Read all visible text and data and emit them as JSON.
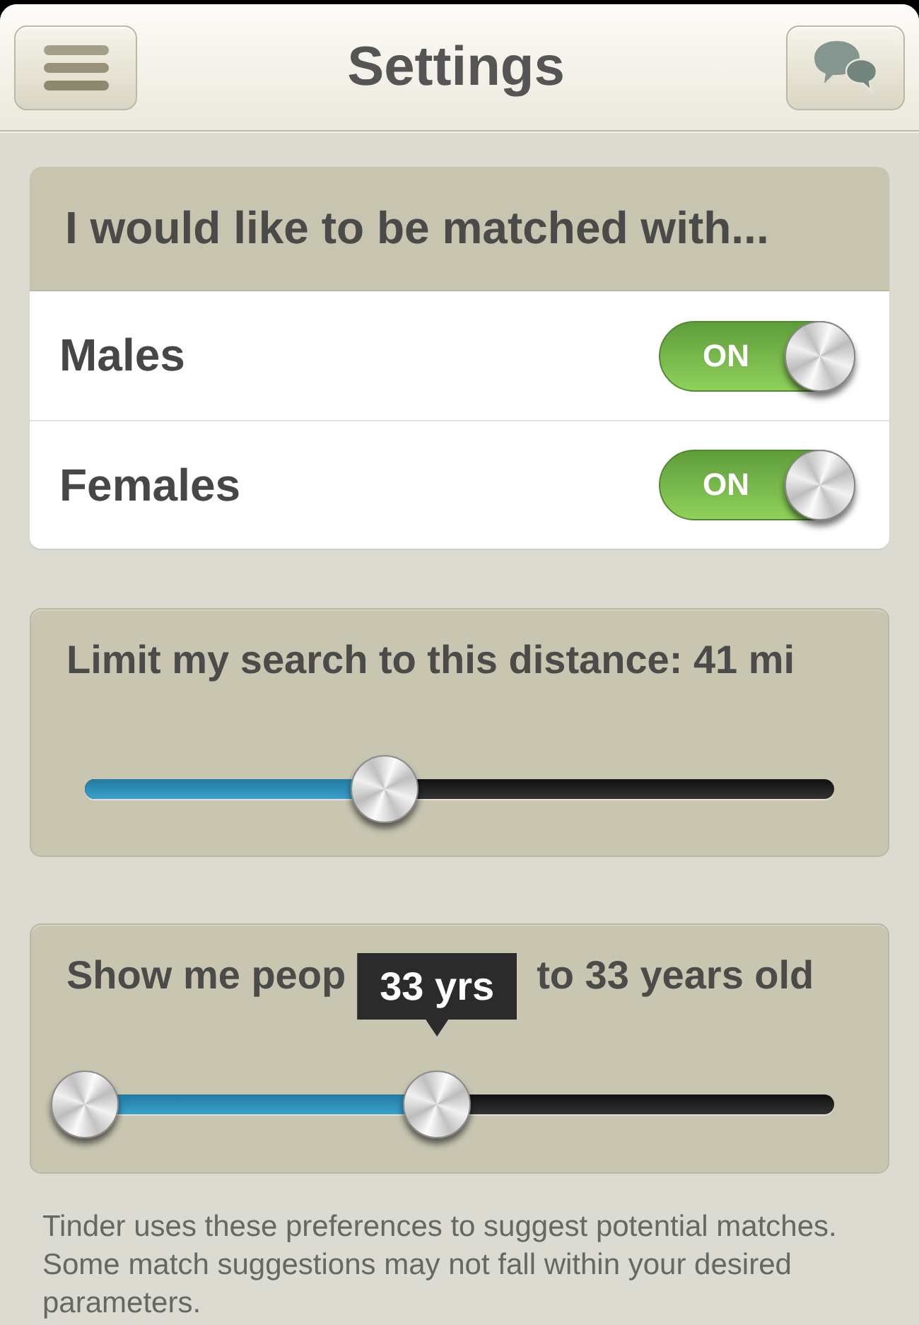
{
  "nav": {
    "title": "Settings"
  },
  "match_card": {
    "heading": "I would like to be matched with...",
    "options": [
      {
        "label": "Males",
        "on": true,
        "switch_text": "ON"
      },
      {
        "label": "Females",
        "on": true,
        "switch_text": "ON"
      }
    ]
  },
  "distance_card": {
    "label": "Limit my search to this distance: 41 mi",
    "level": 0.4
  },
  "age_card": {
    "label_start": "Show me peop",
    "label_end": "to 33 years old",
    "tooltip": "33 yrs",
    "thumbs": [
      {
        "level": 0
      },
      {
        "level": 0.47
      }
    ]
  },
  "footer": "Tinder uses these preferences to suggest potential matches. Some match suggestions may not fall within your desired parameters."
}
